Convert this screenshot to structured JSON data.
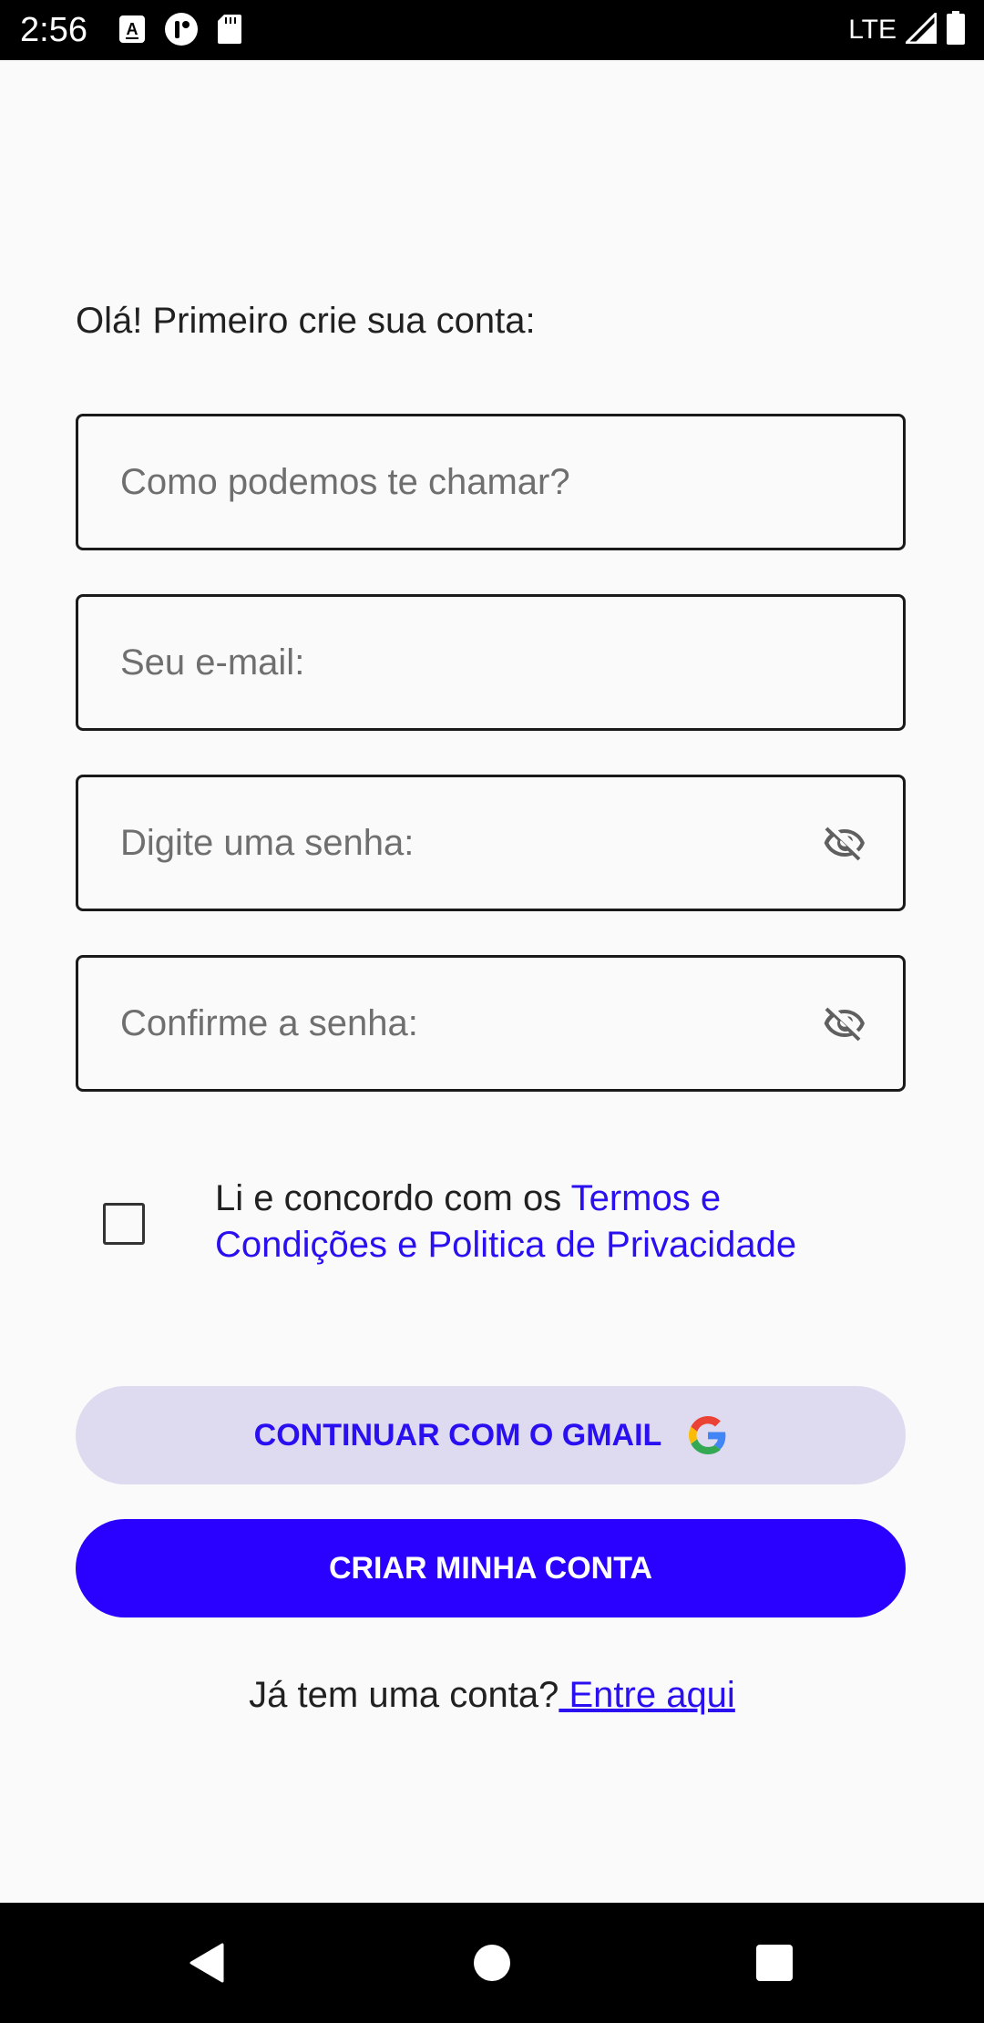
{
  "status_bar": {
    "time": "2:56",
    "network": "LTE"
  },
  "form": {
    "greeting": "Olá! Primeiro crie sua conta:",
    "name_placeholder": "Como podemos te chamar?",
    "email_placeholder": "Seu e-mail:",
    "password_placeholder": "Digite uma senha:",
    "confirm_placeholder": "Confirme a senha:",
    "terms_prefix": "Li e concordo com os ",
    "terms_link": "Termos e Condições e Politica de Privacidade",
    "terms_checked": false
  },
  "buttons": {
    "gmail": "CONTINUAR COM O GMAIL",
    "create": "CRIAR MINHA CONTA"
  },
  "login": {
    "prompt": "Já tem uma conta?",
    "link": " Entre aqui"
  },
  "colors": {
    "accent": "#2a00ff",
    "link": "#2a10f0",
    "secondary_button": "#dedbf0"
  }
}
